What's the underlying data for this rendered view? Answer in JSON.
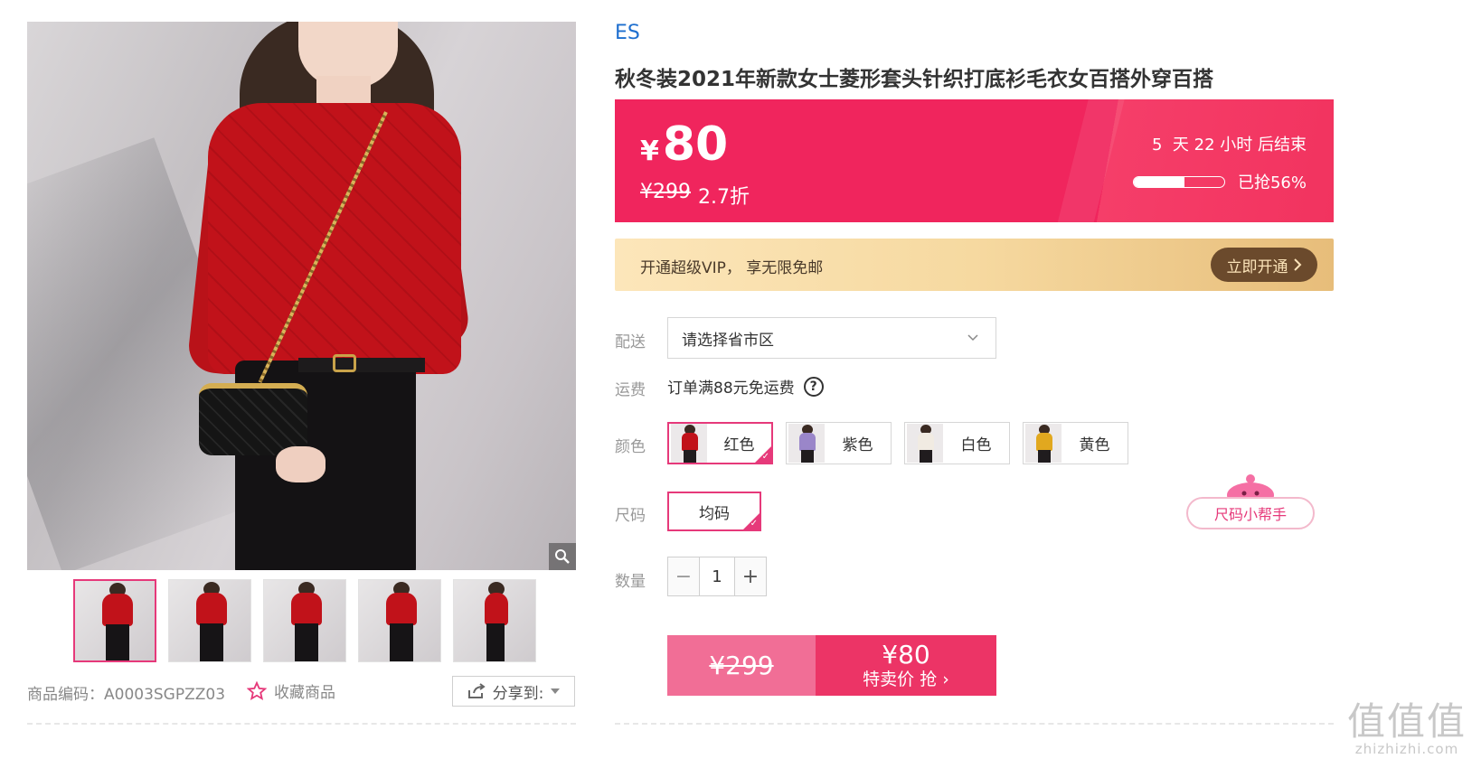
{
  "brand": "ES",
  "title": "秋冬装2021年新款女士菱形套头针织打底衫毛衣女百搭外穿百搭",
  "promo": {
    "currency": "¥",
    "price": "80",
    "original_price": "¥299",
    "discount": "2.7折",
    "countdown": "5  天 22 小时 后结束",
    "sold_label": "已抢56%",
    "sold_fraction": 0.56
  },
  "vip": {
    "text": "开通超级VIP， 享无限免邮",
    "button": "立即开通"
  },
  "delivery": {
    "label": "配送",
    "placeholder": "请选择省市区"
  },
  "freight": {
    "label": "运费",
    "text": "订单满88元免运费",
    "help": "?"
  },
  "color": {
    "label": "颜色",
    "options": [
      {
        "name": "红色",
        "swatch": "#c1121a",
        "selected": true
      },
      {
        "name": "紫色",
        "swatch": "#9a86c9",
        "selected": false
      },
      {
        "name": "白色",
        "swatch": "#f1ebe2",
        "selected": false
      },
      {
        "name": "黄色",
        "swatch": "#e1a81f",
        "selected": false
      }
    ]
  },
  "size": {
    "label": "尺码",
    "option": "均码",
    "helper": "尺码小帮手"
  },
  "quantity": {
    "label": "数量",
    "value": "1",
    "minus": "−",
    "plus": "+"
  },
  "buy": {
    "original": "¥299",
    "price": "¥80",
    "action": "特卖价 抢 ›"
  },
  "gallery": {
    "thumbnails": 5,
    "sku": "商品编码：A0003SGPZZ03",
    "favorite": "收藏商品",
    "share": "分享到:"
  },
  "watermark": {
    "big": "值值值",
    "small": "zhizhizhi.com"
  },
  "colors": {
    "accent": "#f0255d",
    "pink": "#e6397a",
    "brand_blue": "#1e6fcf",
    "vip_button": "#6b4a2c"
  }
}
